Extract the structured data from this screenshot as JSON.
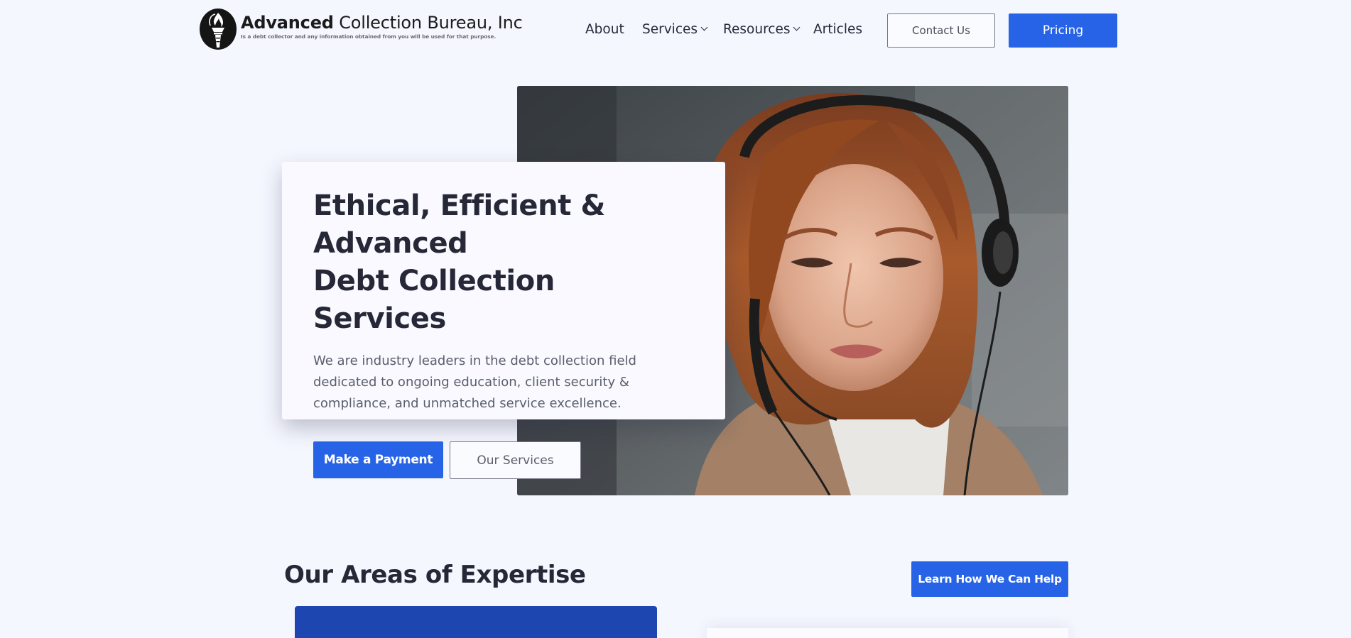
{
  "header": {
    "logo": {
      "name_bold": "Advanced",
      "name_rest": " Collection Bureau, Inc",
      "tagline": "Is a debt collector and any information obtained from you will be used for that purpose."
    },
    "nav": [
      {
        "label": "About",
        "has_dropdown": false
      },
      {
        "label": "Services",
        "has_dropdown": true
      },
      {
        "label": "Resources",
        "has_dropdown": true
      },
      {
        "label": "Articles",
        "has_dropdown": false
      }
    ],
    "contact_label": "Contact Us",
    "pricing_label": "Pricing"
  },
  "hero": {
    "title_line1": "Ethical, Efficient & Advanced",
    "title_line2": "Debt Collection Services",
    "description": "We are industry leaders in the debt collection field dedicated to ongoing education, client security & compliance, and unmatched service excellence.",
    "primary_button": "Make a Payment",
    "secondary_button": "Our Services",
    "image": "woman-with-headset-photo"
  },
  "expertise": {
    "title": "Our Areas of Expertise",
    "cta_label": "Learn How We Can Help"
  },
  "colors": {
    "background": "#f5f7ff",
    "accent": "#2763e6",
    "card_blue": "#1e46b0",
    "text_dark": "#262838"
  }
}
